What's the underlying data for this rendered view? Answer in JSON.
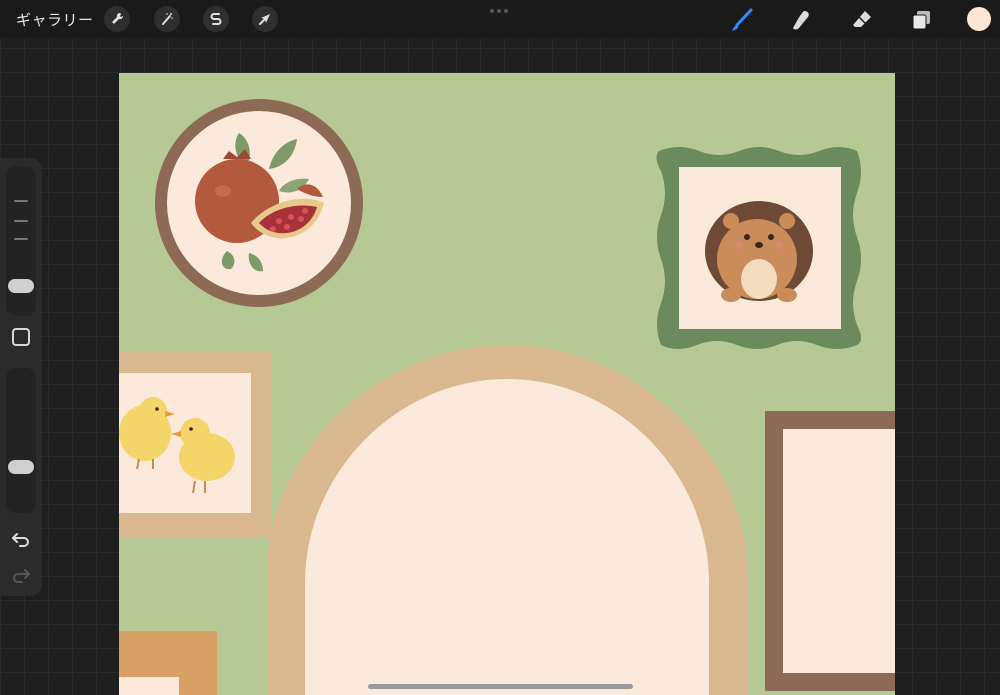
{
  "topbar": {
    "gallery_label": "ギャラリー",
    "left_tools": [
      {
        "icon": "wrench-icon",
        "name": "actions"
      },
      {
        "icon": "magic-wand-icon",
        "name": "adjustments"
      },
      {
        "icon": "selection-s-icon",
        "name": "selection"
      },
      {
        "icon": "arrow-cursor-icon",
        "name": "transform"
      }
    ],
    "right_tools": [
      {
        "icon": "brush-icon",
        "name": "paint",
        "active": true
      },
      {
        "icon": "smudge-icon",
        "name": "smudge"
      },
      {
        "icon": "eraser-icon",
        "name": "eraser"
      },
      {
        "icon": "layers-icon",
        "name": "layers"
      }
    ],
    "current_color": "#fde6d4"
  },
  "sidebar": {
    "brush_size_level": 0.55,
    "opacity_level": 0.65
  },
  "colors": {
    "accent": "#2d8cff",
    "canvas_background": "#b6c894",
    "frame_dark_brown": "#8c6a56",
    "frame_tan": "#d9b88f",
    "frame_green": "#6b8a5e",
    "frame_orange": "#d9a066",
    "paper_cream": "#fbeadb"
  }
}
